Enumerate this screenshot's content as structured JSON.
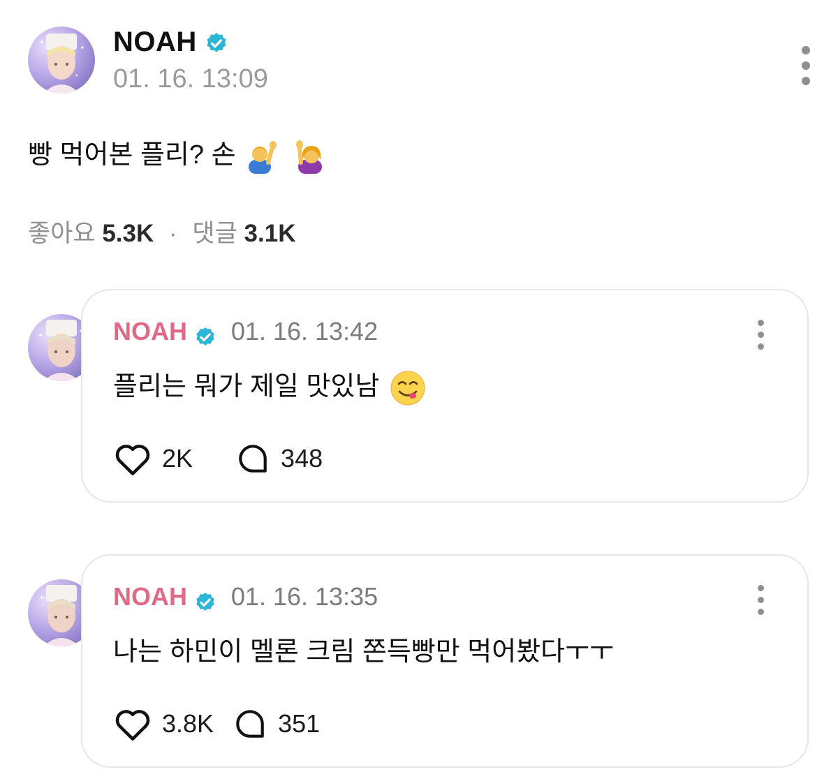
{
  "post": {
    "author": "NOAH",
    "timestamp": "01. 16. 13:09",
    "text": "빵 먹어본 플리? 손",
    "emojis": [
      "man-raising-hand-icon",
      "woman-raising-hand-icon"
    ],
    "stats": {
      "likes_label": "좋아요",
      "likes_count": "5.3K",
      "separator": "·",
      "comments_label": "댓글",
      "comments_count": "3.1K"
    }
  },
  "replies": [
    {
      "author": "NOAH",
      "timestamp": "01. 16. 13:42",
      "text": "플리는 뭐가 제일 맛있남",
      "emoji": "face-savoring-food-icon",
      "likes": "2K",
      "comments": "348"
    },
    {
      "author": "NOAH",
      "timestamp": "01. 16. 13:35",
      "text": "나는 하민이 멜론 크림 쫀득빵만 먹어봤다ㅜㅜ",
      "likes": "3.8K",
      "comments": "351"
    }
  ],
  "colors": {
    "verified": "#2bb5d6",
    "reply_name": "#e06a86",
    "muted": "#9a9a9a",
    "card_border": "#e6e6e6"
  }
}
